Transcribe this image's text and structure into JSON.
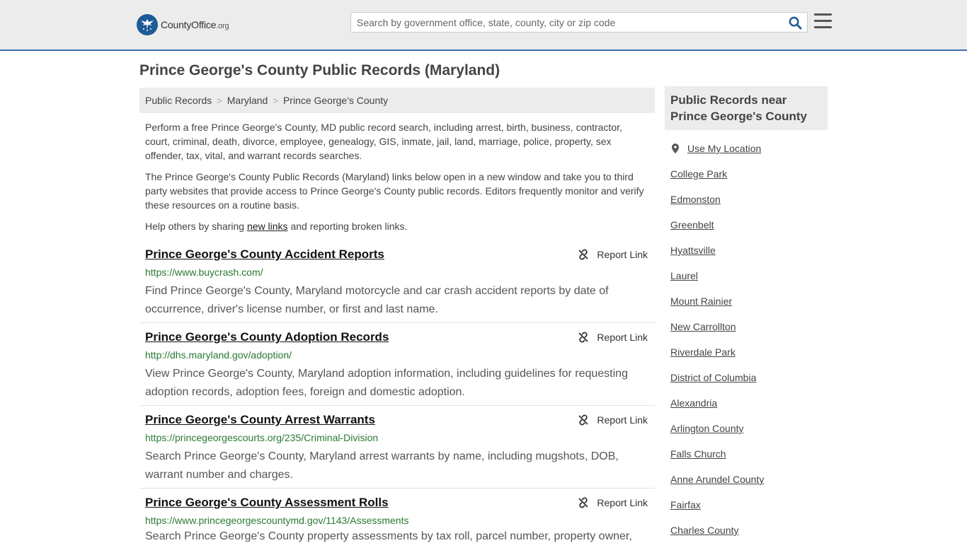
{
  "header": {
    "logo_text": "CountyOffice",
    "logo_tld": ".org",
    "search_placeholder": "Search by government office, state, county, city or zip code"
  },
  "page": {
    "title": "Prince George's County Public Records (Maryland)"
  },
  "breadcrumb": [
    "Public Records",
    "Maryland",
    "Prince George's County"
  ],
  "intro": {
    "p1": "Perform a free Prince George's County, MD public record search, including arrest, birth, business, contractor, court, criminal, death, divorce, employee, genealogy, GIS, inmate, jail, land, marriage, police, property, sex offender, tax, vital, and warrant records searches.",
    "p2": "The Prince George's County Public Records (Maryland) links below open in a new window and take you to third party websites that provide access to Prince George's County public records. Editors frequently monitor and verify these resources on a routine basis.",
    "p3_before": "Help others by sharing ",
    "p3_link": "new links",
    "p3_after": " and reporting broken links."
  },
  "report_label": "Report Link",
  "records": [
    {
      "title": "Prince George's County Accident Reports",
      "url": "https://www.buycrash.com/",
      "description": "Find Prince George's County, Maryland motorcycle and car crash accident reports by date of occurrence, driver's license number, or first and last name."
    },
    {
      "title": "Prince George's County Adoption Records",
      "url": "http://dhs.maryland.gov/adoption/",
      "description": "View Prince George's County, Maryland adoption information, including guidelines for requesting adoption records, adoption fees, foreign and domestic adoption."
    },
    {
      "title": "Prince George's County Arrest Warrants",
      "url": "https://princegeorgescourts.org/235/Criminal-Division",
      "description": "Search Prince George's County, Maryland arrest warrants by name, including mugshots, DOB, warrant number and charges."
    },
    {
      "title": "Prince George's County Assessment Rolls",
      "url": "https://www.princegeorgescountymd.gov/1143/Assessments",
      "description": "Search Prince George's County property assessments by tax roll, parcel number, property owner,"
    }
  ],
  "sidebar": {
    "heading": "Public Records near Prince George's County",
    "use_location": "Use My Location",
    "links": [
      "College Park",
      "Edmonston",
      "Greenbelt",
      "Hyattsville",
      "Laurel",
      "Mount Rainier",
      "New Carrollton",
      "Riverdale Park",
      "District of Columbia",
      "Alexandria",
      "Arlington County",
      "Falls Church",
      "Anne Arundel County",
      "Fairfax",
      "Charles County"
    ]
  },
  "colors": {
    "accent": "#1d5a97",
    "url_green": "#2a7a33",
    "header_bg": "#ececec"
  }
}
